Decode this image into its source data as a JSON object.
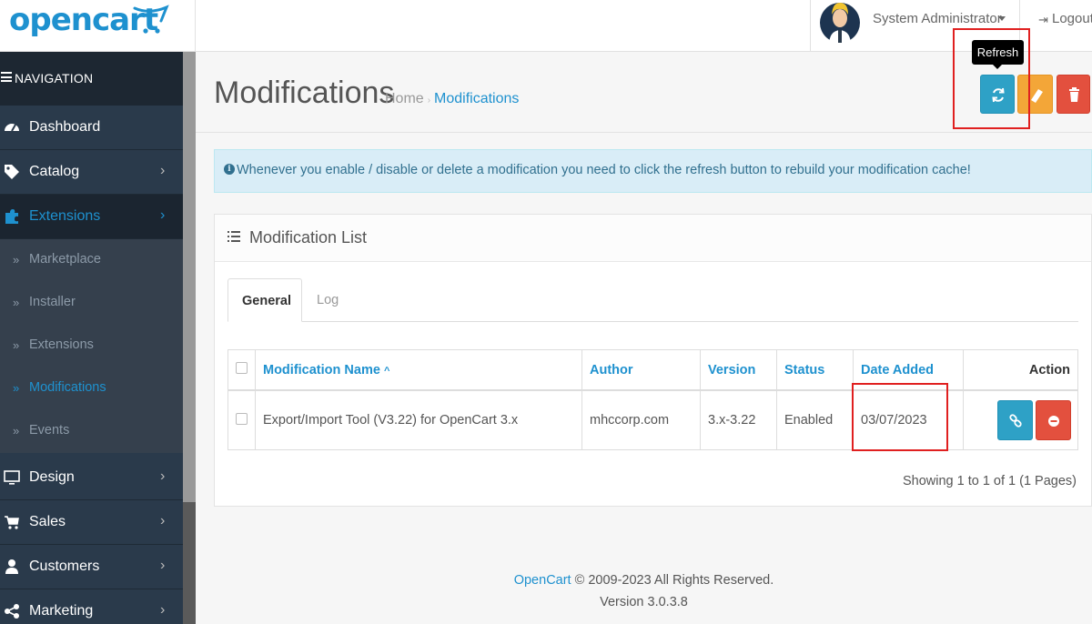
{
  "header": {
    "logo_text": "opencart",
    "user_name": "System Administrator",
    "logout_label": "Logout"
  },
  "sidebar": {
    "heading": "NAVIGATION",
    "items": [
      {
        "label": "Dashboard",
        "icon": "dashboard-icon"
      },
      {
        "label": "Catalog",
        "icon": "tags-icon"
      },
      {
        "label": "Extensions",
        "icon": "puzzle-icon",
        "active": true
      },
      {
        "label": "Design",
        "icon": "monitor-icon"
      },
      {
        "label": "Sales",
        "icon": "cart-icon"
      },
      {
        "label": "Customers",
        "icon": "user-icon"
      },
      {
        "label": "Marketing",
        "icon": "share-icon"
      }
    ],
    "sub_items": [
      {
        "label": "Marketplace"
      },
      {
        "label": "Installer"
      },
      {
        "label": "Extensions"
      },
      {
        "label": "Modifications",
        "current": true
      },
      {
        "label": "Events"
      }
    ]
  },
  "page": {
    "title": "Modifications",
    "breadcrumb": [
      "Home",
      "Modifications"
    ],
    "tooltip": "Refresh"
  },
  "alert": {
    "text": "Whenever you enable / disable or delete a modification you need to click the refresh button to rebuild your modification cache!"
  },
  "panel": {
    "title": "Modification List",
    "tabs": [
      "General",
      "Log"
    ],
    "columns": [
      "Modification Name",
      "Author",
      "Version",
      "Status",
      "Date Added",
      "Action"
    ],
    "rows": [
      {
        "name": "Export/Import Tool (V3.22) for OpenCart 3.x",
        "author": "mhccorp.com",
        "version": "3.x-3.22",
        "status": "Enabled",
        "date_added": "03/07/2023"
      }
    ],
    "pagination_text": "Showing 1 to 1 of 1 (1 Pages)"
  },
  "footer": {
    "brand": "OpenCart",
    "copyright": " © 2009-2023 All Rights Reserved.",
    "version": "Version 3.0.3.8"
  },
  "colors": {
    "accent": "#1e91cf",
    "sidebar_bg": "#2a3a4b",
    "refresh_button": "#2ea1c6",
    "clear_button": "#f3a638",
    "delete_button": "#e3503e",
    "highlight_box": "#e02020"
  }
}
